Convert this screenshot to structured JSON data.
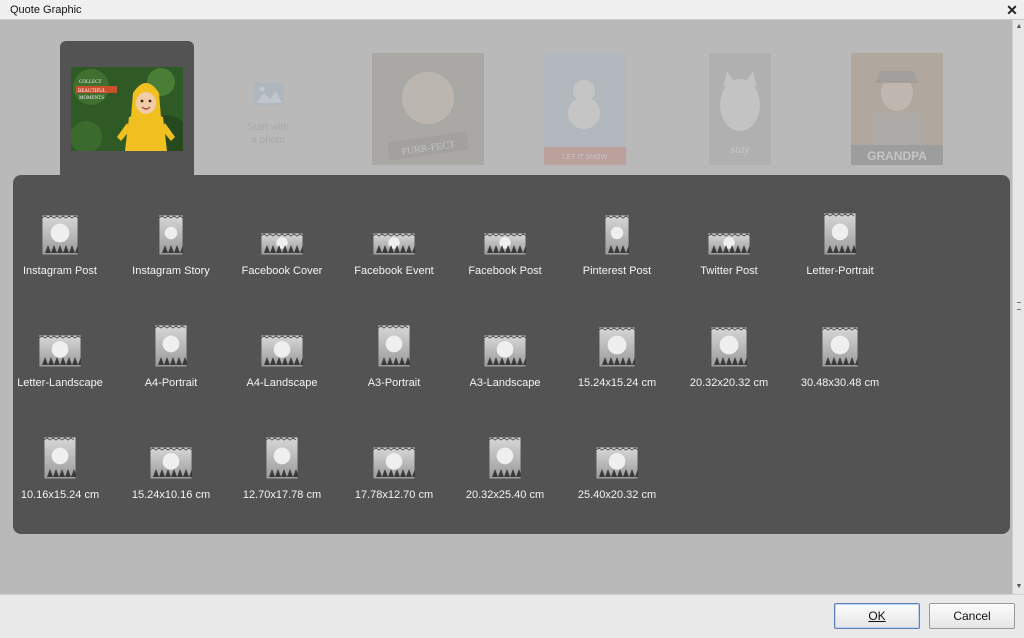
{
  "window": {
    "title": "Quote Graphic",
    "close_label": "✕"
  },
  "thumbnails": [
    {
      "name": "thumb-collect-beautiful-moments",
      "text": "COLLECT BEAUTIFUL MOMENTS",
      "selected": true
    },
    {
      "name": "thumb-start-with-photo",
      "line1": "Start with",
      "line2": "a photo"
    },
    {
      "name": "thumb-purr-fect",
      "text": "PURR-FECT"
    },
    {
      "name": "thumb-let-it-snow",
      "text": "LET IT SNOW"
    },
    {
      "name": "thumb-stay",
      "text": "stay"
    },
    {
      "name": "thumb-grandpa",
      "text": "GRANDPA"
    }
  ],
  "sizes": {
    "row1": [
      "Instagram Post",
      "Instagram Story",
      "Facebook Cover",
      "Facebook Event",
      "Facebook Post",
      "Pinterest Post",
      "Twitter Post",
      "Letter-Portrait"
    ],
    "row2": [
      "Letter-Landscape",
      "A4-Portrait",
      "A4-Landscape",
      "A3-Portrait",
      "A3-Landscape",
      "15.24x15.24 cm",
      "20.32x20.32 cm",
      "30.48x30.48 cm"
    ],
    "row3": [
      "10.16x15.24 cm",
      "15.24x10.16 cm",
      "12.70x17.78 cm",
      "17.78x12.70 cm",
      "20.32x25.40 cm",
      "25.40x20.32 cm"
    ]
  },
  "buttons": {
    "ok": "OK",
    "cancel": "Cancel"
  },
  "colors": {
    "panel": "#535353",
    "background": "#b9b9b9",
    "accent": "#f0c020"
  }
}
